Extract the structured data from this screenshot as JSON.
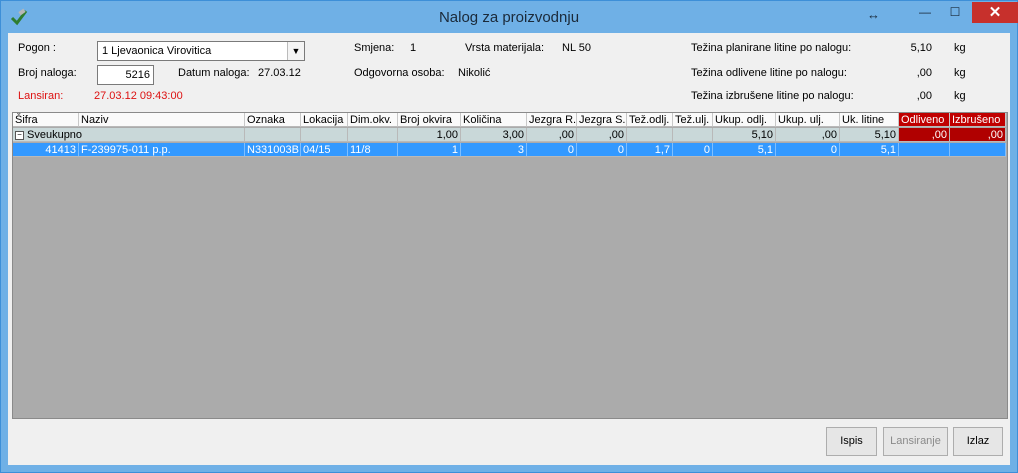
{
  "window": {
    "title": "Nalog za proizvodnju"
  },
  "form": {
    "pogon_label": "Pogon :",
    "pogon_value": "1 Ljevaonica Virovitica",
    "broj_naloga_label": "Broj naloga:",
    "broj_naloga_value": "5216",
    "datum_label": "Datum naloga:",
    "datum_value": "27.03.12",
    "lansiran_label": "Lansiran:",
    "lansiran_value": "27.03.12 09:43:00",
    "smjena_label": "Smjena:",
    "smjena_value": "1",
    "vrsta_label": "Vrsta materijala:",
    "vrsta_value": "NL 50",
    "odgovorna_label": "Odgovorna osoba:",
    "odgovorna_value": "Nikolić",
    "tezina_planirane_label": "Težina planirane litine po nalogu:",
    "tezina_planirane_value": "5,10",
    "tezina_odlivene_label": "Težina odlivene litine po nalogu:",
    "tezina_odlivene_value": ",00",
    "tezina_izbrusene_label": "Težina izbrušene litine po nalogu:",
    "tezina_izbrusene_value": ",00",
    "unit": "kg"
  },
  "table": {
    "headers": [
      "Šifra",
      "Naziv",
      "Oznaka",
      "Lokacija",
      "Dim.okv.",
      "Broj okvira",
      "Količina",
      "Jezgra R.",
      "Jezgra S.",
      "Tež.odlj.",
      "Tež.ulj.",
      "Ukup. odlj.",
      "Ukup. ulj.",
      "Uk. litine",
      "Odliveno",
      "Izbrušeno"
    ],
    "group_row": [
      "Sveukupno",
      "",
      "",
      "",
      "",
      "1,00",
      "3,00",
      ",00",
      ",00",
      "",
      "",
      "5,10",
      ",00",
      "5,10",
      ",00",
      ",00"
    ],
    "rows": [
      [
        "41413",
        "F-239975-011 p.p.",
        "N331003B",
        "04/15",
        "11/8",
        "1",
        "3",
        "0",
        "0",
        "1,7",
        "0",
        "5,1",
        "0",
        "5,1",
        "",
        ""
      ]
    ]
  },
  "buttons": {
    "ispis": "Ispis",
    "lansiranje": "Lansiranje",
    "izlaz": "Izlaz"
  },
  "colors": {
    "titlebar": "#6fb0e6",
    "close": "#c7302c",
    "selection": "#3399ff",
    "alert_header": "#c00000",
    "group_row": "#c9d8d9"
  }
}
